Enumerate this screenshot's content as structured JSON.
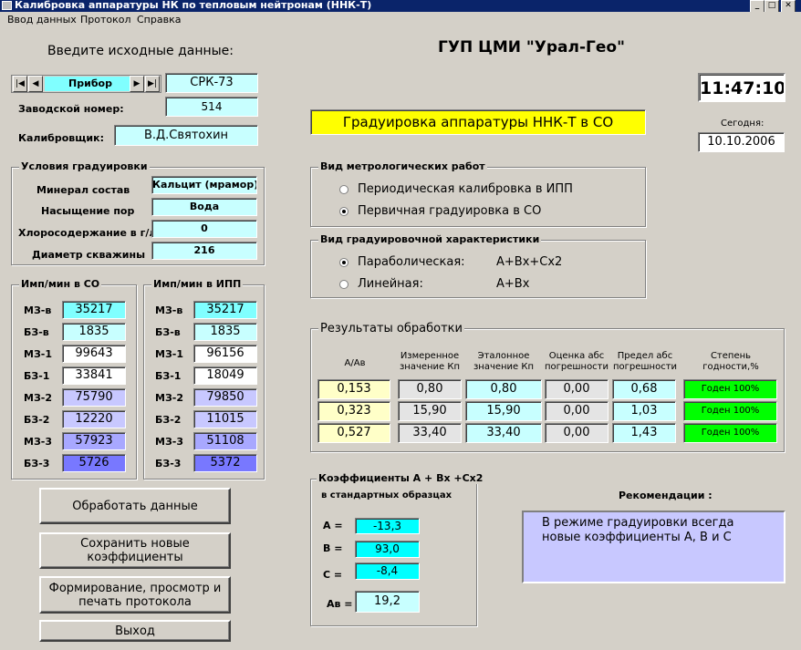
{
  "window": {
    "title": "Калибровка аппаратуры НК по тепловым нейтронам (ННК-Т)"
  },
  "menu": [
    "Ввод данных",
    "Протокол",
    "Справка"
  ],
  "left": {
    "heading": "Введите исходные данные:",
    "nav_label": "Прибор",
    "device": "СРК-73",
    "serial_label": "Заводской номер:",
    "serial": "514",
    "calibrator_label": "Калибровщик:",
    "calibrator": "В.Д.Святохин"
  },
  "conditions": {
    "title": "Условия градуировки",
    "rows": [
      {
        "label": "Минерал  состав",
        "value": "Кальцит (мрамор)"
      },
      {
        "label": "Насыщение пор",
        "value": "Вода"
      },
      {
        "label": "Хлоросодержание в г/л",
        "value": "0"
      },
      {
        "label": "Диаметр скважины",
        "value": "216"
      }
    ]
  },
  "co": {
    "title": "Имп/мин в СО",
    "rows": [
      {
        "label": "МЗ-в",
        "value": "35217"
      },
      {
        "label": "БЗ-в",
        "value": "1835"
      },
      {
        "label": "МЗ-1",
        "value": "99643"
      },
      {
        "label": "БЗ-1",
        "value": "33841"
      },
      {
        "label": "МЗ-2",
        "value": "75790"
      },
      {
        "label": "БЗ-2",
        "value": "12220"
      },
      {
        "label": "МЗ-3",
        "value": "57923"
      },
      {
        "label": "БЗ-3",
        "value": "5726"
      }
    ]
  },
  "ipp": {
    "title": "Имп/мин в ИПП",
    "rows": [
      {
        "label": "МЗ-в",
        "value": "35217"
      },
      {
        "label": "БЗ-в",
        "value": "1835"
      },
      {
        "label": "МЗ-1",
        "value": "96156"
      },
      {
        "label": "БЗ-1",
        "value": "18049"
      },
      {
        "label": "МЗ-2",
        "value": "79850"
      },
      {
        "label": "БЗ-2",
        "value": "11015"
      },
      {
        "label": "МЗ-3",
        "value": "51108"
      },
      {
        "label": "БЗ-3",
        "value": "5372"
      }
    ]
  },
  "buttons": {
    "process": "Обработать данные",
    "save": "Сохранить новые коэффициенты",
    "protocol": "Формирование, просмотр и печать протокола",
    "exit": "Выход"
  },
  "header": {
    "org": "ГУП ЦМИ \"Урал-Гео\"",
    "time": "11:47:10",
    "today_label": "Сегодня:",
    "date": "10.10.2006",
    "banner": "Градуировка аппаратуры ННК-Т в СО"
  },
  "work_type": {
    "title": "Вид метрологических работ",
    "options": [
      {
        "label": "Периодическая калибровка в ИПП",
        "selected": false
      },
      {
        "label": "Первичная градуировка в СО",
        "selected": true
      }
    ]
  },
  "characteristic": {
    "title": "Вид градуировочной характеристики",
    "options": [
      {
        "label": "Параболическая:",
        "formula": "А+Вх+Сх2",
        "selected": true
      },
      {
        "label": "Линейная:",
        "formula": "А+Вх",
        "selected": false
      }
    ]
  },
  "results": {
    "title": "Результаты обработки",
    "headers": [
      "А/Ав",
      "Измеренное значение Кп",
      "Эталонное значение Кп",
      "Оценка абс погрешности",
      "Предел абс погрешности",
      "Степень годности,%"
    ],
    "rows": [
      [
        "0,153",
        "0,80",
        "0,80",
        "0,00",
        "0,68",
        "Годен 100%"
      ],
      [
        "0,323",
        "15,90",
        "15,90",
        "0,00",
        "1,03",
        "Годен 100%"
      ],
      [
        "0,527",
        "33,40",
        "33,40",
        "0,00",
        "1,43",
        "Годен 100%"
      ]
    ]
  },
  "coeffs": {
    "title": "Коэффициенты А + Вх +Сх2",
    "subtitle": "в стандартных  образцах",
    "rows": [
      {
        "label": "А =",
        "value": "-13,3"
      },
      {
        "label": "В =",
        "value": "93,0"
      },
      {
        "label": "С =",
        "value": "-8,4"
      }
    ],
    "av_label": "Ав =",
    "av": "19,2"
  },
  "recommend": {
    "title": "Рекомендации :",
    "text": "В режиме градуировки всегда новые коэффициенты А, В и С"
  }
}
